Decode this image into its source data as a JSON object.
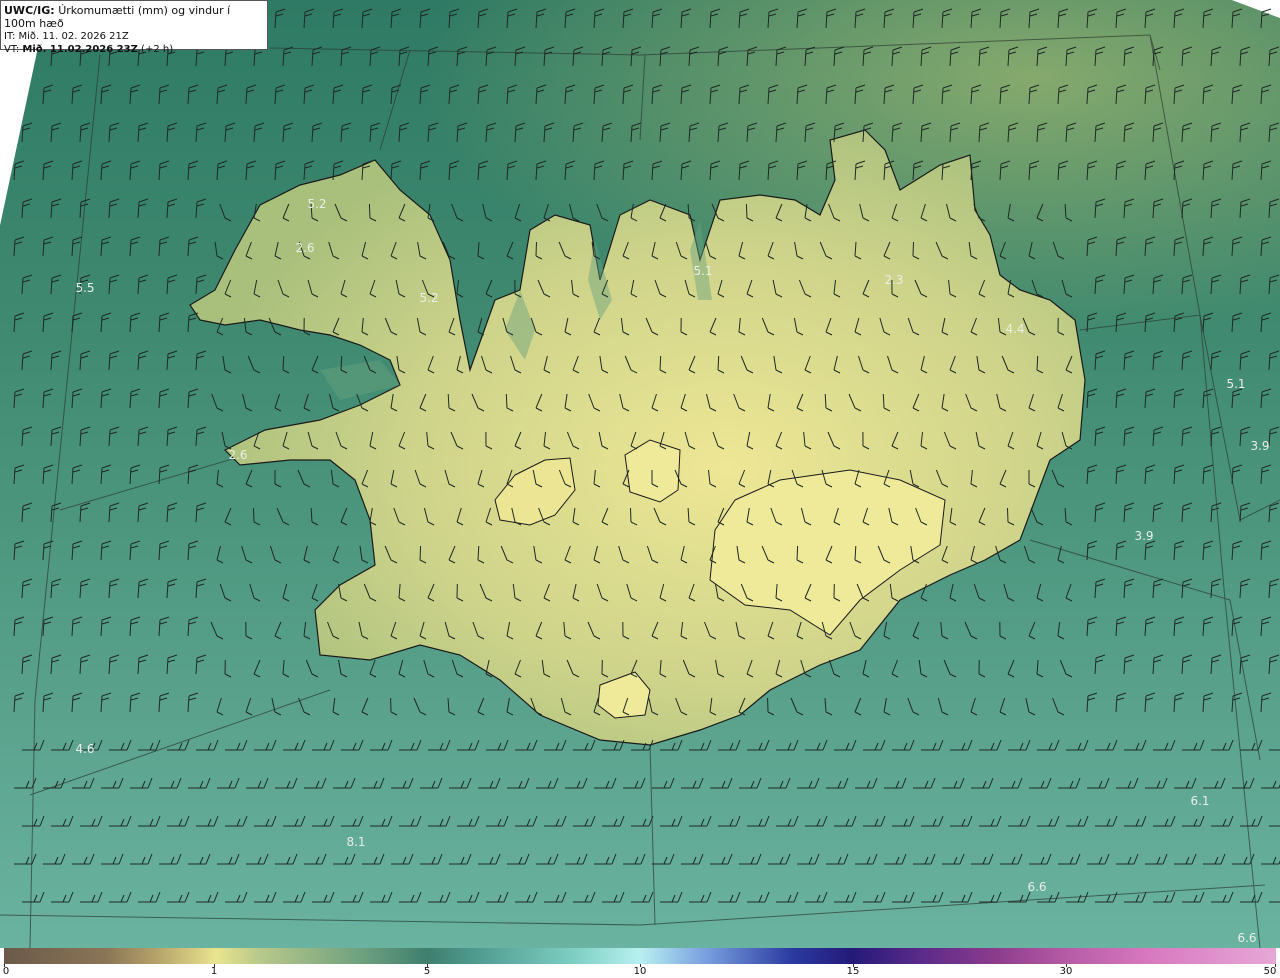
{
  "header": {
    "model": "UWC/IG:",
    "title": "Úrkomumætti (mm) og vindur í 100m hæð",
    "issue_time": "IT: Mið. 11. 02. 2026 21Z",
    "valid_prefix": "VT: ",
    "valid_time": "Mið. 11.02.2026 23Z",
    "valid_offset": " (+2 h)"
  },
  "map_labels": [
    {
      "text": "5.2"
    },
    {
      "text": "2.6"
    },
    {
      "text": "5.2"
    },
    {
      "text": "5.5"
    },
    {
      "text": "5.1"
    },
    {
      "text": "2.3"
    },
    {
      "text": "4.4"
    },
    {
      "text": "5.1"
    },
    {
      "text": "3.9"
    },
    {
      "text": "3.9"
    },
    {
      "text": "2.6"
    },
    {
      "text": "4.6"
    },
    {
      "text": "6.1"
    },
    {
      "text": "8.1"
    },
    {
      "text": "6.6"
    },
    {
      "text": "6.6"
    }
  ],
  "colorbar": {
    "ticks": [
      "0",
      "1",
      "5",
      "10",
      "15",
      "30",
      "50"
    ],
    "colors": {
      "ocean_north": "#4a8a6c",
      "ocean_south": "#5ea596",
      "land_high": "#e6e28f",
      "land_low": "#a8bd7a"
    }
  }
}
